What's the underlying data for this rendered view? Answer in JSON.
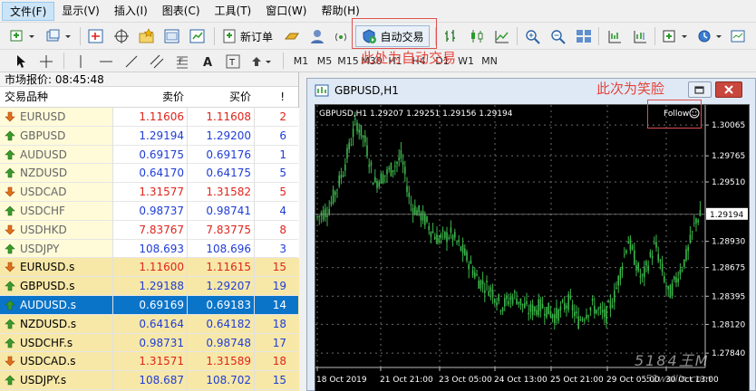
{
  "menu": [
    {
      "label": "文件(F)",
      "active": true
    },
    {
      "label": "显示(V)"
    },
    {
      "label": "插入(I)"
    },
    {
      "label": "图表(C)"
    },
    {
      "label": "工具(T)"
    },
    {
      "label": "窗口(W)"
    },
    {
      "label": "帮助(H)"
    }
  ],
  "toolbar": {
    "new_order_label": "新订单",
    "auto_trade_label": "自动交易"
  },
  "periods": [
    "M1",
    "M5",
    "M15",
    "M30",
    "H1",
    "H4",
    "D1",
    "W1",
    "MN"
  ],
  "market_watch": {
    "title": "市场报价: 08:45:48",
    "col_symbol": "交易品种",
    "col_bid": "卖价",
    "col_ask": "买价",
    "col_spread": "!",
    "rows": [
      {
        "symbol": "EURUSD",
        "bid": "1.11606",
        "ask": "1.11608",
        "spread": "2",
        "dir": "down"
      },
      {
        "symbol": "GBPUSD",
        "bid": "1.29194",
        "ask": "1.29200",
        "spread": "6",
        "dir": "up"
      },
      {
        "symbol": "AUDUSD",
        "bid": "0.69175",
        "ask": "0.69176",
        "spread": "1",
        "dir": "up"
      },
      {
        "symbol": "NZDUSD",
        "bid": "0.64170",
        "ask": "0.64175",
        "spread": "5",
        "dir": "up"
      },
      {
        "symbol": "USDCAD",
        "bid": "1.31577",
        "ask": "1.31582",
        "spread": "5",
        "dir": "down"
      },
      {
        "symbol": "USDCHF",
        "bid": "0.98737",
        "ask": "0.98741",
        "spread": "4",
        "dir": "up"
      },
      {
        "symbol": "USDHKD",
        "bid": "7.83767",
        "ask": "7.83775",
        "spread": "8",
        "dir": "down"
      },
      {
        "symbol": "USDJPY",
        "bid": "108.693",
        "ask": "108.696",
        "spread": "3",
        "dir": "up"
      },
      {
        "symbol": "EURUSD.s",
        "bid": "1.11600",
        "ask": "1.11615",
        "spread": "15",
        "dir": "down"
      },
      {
        "symbol": "GBPUSD.s",
        "bid": "1.29188",
        "ask": "1.29207",
        "spread": "19",
        "dir": "up"
      },
      {
        "symbol": "AUDUSD.s",
        "bid": "0.69169",
        "ask": "0.69183",
        "spread": "14",
        "dir": "up"
      },
      {
        "symbol": "NZDUSD.s",
        "bid": "0.64164",
        "ask": "0.64182",
        "spread": "18",
        "dir": "up"
      },
      {
        "symbol": "USDCHF.s",
        "bid": "0.98731",
        "ask": "0.98748",
        "spread": "17",
        "dir": "up"
      },
      {
        "symbol": "USDCAD.s",
        "bid": "1.31571",
        "ask": "1.31589",
        "spread": "18",
        "dir": "down"
      },
      {
        "symbol": "USDJPY.s",
        "bid": "108.687",
        "ask": "108.702",
        "spread": "15",
        "dir": "up"
      }
    ]
  },
  "chart_window": {
    "title": "GBPUSD,H1",
    "ohlc_label": "GBPUSD,H1  1.29207 1.29251 1.29156 1.29194",
    "follow_label": "Follow",
    "price_ticks": [
      "1.30065",
      "1.29765",
      "1.29510",
      "1.29194",
      "1.28930",
      "1.28675",
      "1.28395",
      "1.28120",
      "1.27840"
    ],
    "time_ticks": [
      "18 Oct 2019",
      "21 Oct 21:00",
      "23 Oct 05:00",
      "24 Oct 13:00",
      "25 Oct 21:00",
      "29 Oct 05:00",
      "30 Oct 13:00"
    ],
    "current_price": "1.29194"
  },
  "annotations": {
    "auto_trade_note": "此处为自动交易",
    "smiley_note": "此次为笑脸"
  },
  "watermark": "5184王M",
  "watermark_url": "51wailin.com",
  "colors": {
    "up": "#1f3dd6",
    "down": "#e0241b",
    "candle": "#3bb54a",
    "selected": "#0a74c9"
  }
}
